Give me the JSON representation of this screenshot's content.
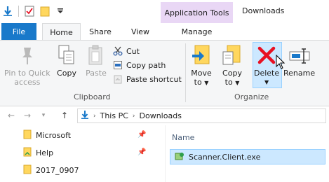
{
  "window": {
    "title": "Downloads",
    "context_group": "Application Tools"
  },
  "tabs": {
    "file": "File",
    "home": "Home",
    "share": "Share",
    "view": "View",
    "manage": "Manage"
  },
  "ribbon": {
    "clipboard": {
      "label": "Clipboard",
      "pin_line1": "Pin to Quick",
      "pin_line2": "access",
      "copy": "Copy",
      "paste": "Paste",
      "cut": "Cut",
      "copy_path": "Copy path",
      "paste_shortcut": "Paste shortcut"
    },
    "organize": {
      "label": "Organize",
      "move_line1": "Move",
      "move_line2": "to",
      "copy_line1": "Copy",
      "copy_line2": "to",
      "delete": "Delete",
      "rename": "Rename"
    }
  },
  "address": {
    "segments": [
      "This PC",
      "Downloads"
    ]
  },
  "nav_pane": {
    "items": [
      {
        "label": "Microsoft",
        "pinned": true
      },
      {
        "label": "Help",
        "pinned": true
      },
      {
        "label": "2017_0907",
        "pinned": false
      }
    ]
  },
  "file_pane": {
    "column_name": "Name",
    "files": [
      {
        "name": "Scanner.Client.exe",
        "selected": true
      }
    ]
  },
  "colors": {
    "file_tab": "#1979ca",
    "context_tab": "#e9d7f5",
    "selection": "#cce8ff",
    "delete_red": "#e81123"
  }
}
